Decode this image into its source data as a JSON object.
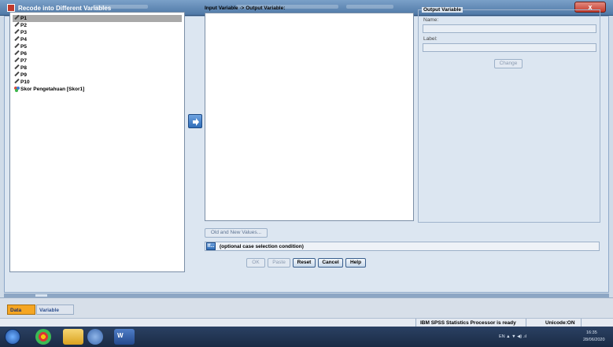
{
  "window": {
    "title": "Recode into Different Variables",
    "close_label": "x"
  },
  "variables": [
    {
      "label": "P1",
      "selected": true,
      "icon": "pencil-icon"
    },
    {
      "label": "P2",
      "icon": "pencil-icon"
    },
    {
      "label": "P3",
      "icon": "pencil-icon"
    },
    {
      "label": "P4",
      "icon": "pencil-icon"
    },
    {
      "label": "P5",
      "icon": "pencil-icon"
    },
    {
      "label": "P6",
      "icon": "pencil-icon"
    },
    {
      "label": "P7",
      "icon": "pencil-icon"
    },
    {
      "label": "P8",
      "icon": "pencil-icon"
    },
    {
      "label": "P9",
      "icon": "pencil-icon"
    },
    {
      "label": "P10",
      "icon": "pencil-icon"
    },
    {
      "label": "Skor Pengetahuan [Skor1]",
      "icon": "nominal-icon"
    }
  ],
  "io": {
    "label": "Input Variable -> Output Variable:"
  },
  "output_variable": {
    "group_title": "Output Variable",
    "name_label": "Name:",
    "label_label": "Label:",
    "change_button": "Change"
  },
  "old_new_button": "Old and New Values...",
  "if_row": {
    "button": "If...",
    "text": "(optional case selection condition)"
  },
  "buttons": {
    "ok": "OK",
    "paste": "Paste",
    "reset": "Reset",
    "cancel": "Cancel",
    "help": "Help"
  },
  "tabs": {
    "data_view": "Data View",
    "variable_view": "Variable View"
  },
  "status": {
    "processor": "IBM SPSS Statistics Processor is ready",
    "unicode": "Unicode:ON"
  },
  "tray": {
    "time": "16:35",
    "date": "28/06/2020"
  },
  "colors": {
    "accent": "#2f6db8",
    "data_view_tab": "#f5a623",
    "title_bar": "#4f78a6"
  }
}
